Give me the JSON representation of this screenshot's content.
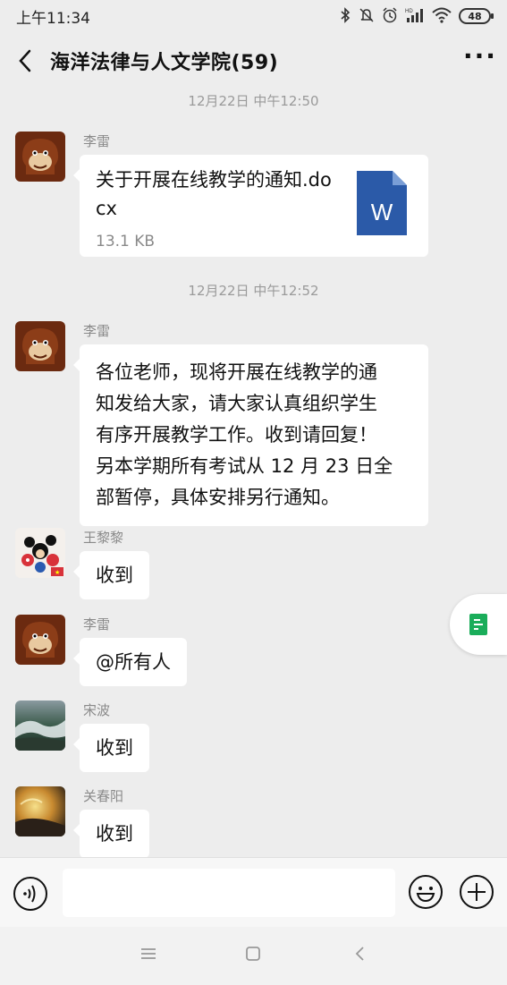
{
  "status_bar": {
    "time": "上午11:34",
    "battery": "48",
    "icons": [
      "bluetooth-icon",
      "mute-icon",
      "alarm-icon",
      "signal-icon",
      "wifi-icon",
      "battery-icon"
    ]
  },
  "header": {
    "title": "海洋法律与人文学院(59)",
    "back_icon": "chevron-left-icon",
    "more_label": "···"
  },
  "timestamps": [
    "12月22日 中午12:50",
    "12月22日 中午12:52"
  ],
  "messages": [
    {
      "sender": "李雷",
      "type": "file",
      "file_name": "关于开展在线教学的通知.docx",
      "file_size": "13.1 KB",
      "file_icon_letter": "W"
    },
    {
      "sender": "李雷",
      "type": "text",
      "lines": [
        "各位老师，现将开展在线教学的通",
        "知发给大家，请大家认真组织学生",
        "有序开展教学工作。收到请回复！",
        "另本学期所有考试从 12 月 23 日全",
        "部暂停，具体安排另行通知。"
      ]
    },
    {
      "sender": "王黎黎",
      "type": "text",
      "text": "收到"
    },
    {
      "sender": "李雷",
      "type": "text",
      "text": "@所有人"
    },
    {
      "sender": "宋波",
      "type": "text",
      "text": "收到"
    },
    {
      "sender": "关春阳",
      "type": "text",
      "text": "收到"
    }
  ],
  "input_bar": {
    "placeholder": "",
    "icons": [
      "voice-icon",
      "emoji-icon",
      "plus-icon"
    ]
  },
  "colors": {
    "background": "#ededed",
    "bubble": "#ffffff",
    "word_blue": "#2b5aa8",
    "float_green": "#1aad5a"
  }
}
